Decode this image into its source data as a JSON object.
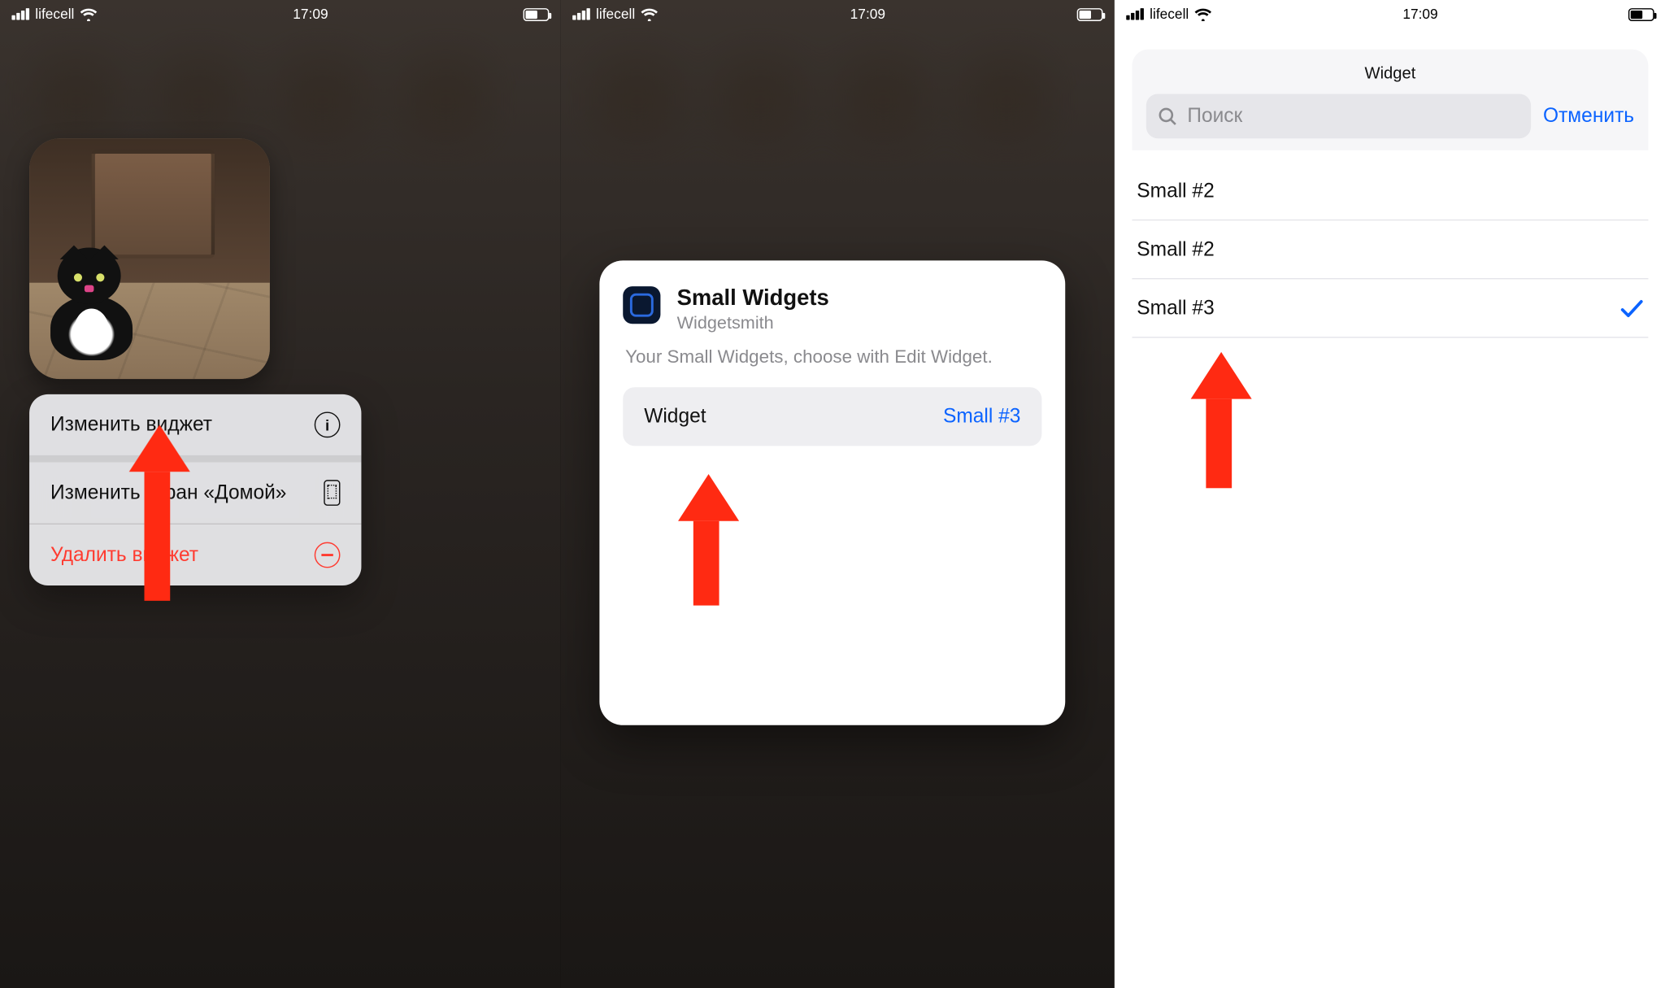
{
  "status": {
    "carrier": "lifecell",
    "time": "17:09"
  },
  "panel1": {
    "menu": {
      "edit_widget": "Изменить виджет",
      "edit_home": "Изменить экран «Домой»",
      "delete_widget": "Удалить виджет"
    }
  },
  "panel2": {
    "title": "Small Widgets",
    "subtitle": "Widgetsmith",
    "description": "Your Small Widgets, choose with Edit Widget.",
    "param_label": "Widget",
    "param_value": "Small #3"
  },
  "panel3": {
    "sheet_title": "Widget",
    "search_placeholder": "Поиск",
    "cancel": "Отменить",
    "options": [
      {
        "label": "Small #2",
        "selected": false
      },
      {
        "label": "Small #2",
        "selected": false
      },
      {
        "label": "Small #3",
        "selected": true
      }
    ]
  }
}
